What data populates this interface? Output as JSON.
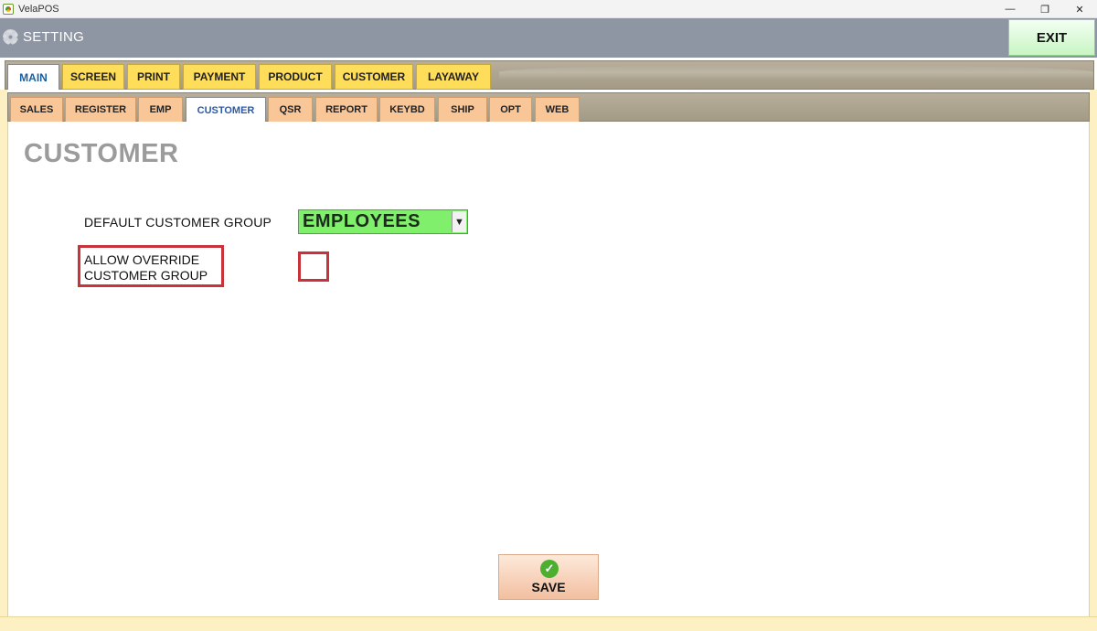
{
  "window": {
    "title": "VelaPOS",
    "controls": {
      "minimize": "—",
      "restore": "❐",
      "close": "✕"
    }
  },
  "header": {
    "title": "SETTING",
    "exit_label": "EXIT"
  },
  "main_tabs": [
    {
      "label": "MAIN",
      "active": true
    },
    {
      "label": "SCREEN",
      "active": false
    },
    {
      "label": "PRINT",
      "active": false
    },
    {
      "label": "PAYMENT",
      "active": false
    },
    {
      "label": "PRODUCT",
      "active": false
    },
    {
      "label": "CUSTOMER",
      "active": false
    },
    {
      "label": "LAYAWAY",
      "active": false
    }
  ],
  "sub_tabs": [
    {
      "label": "SALES",
      "active": false
    },
    {
      "label": "REGISTER",
      "active": false
    },
    {
      "label": "EMP",
      "active": false
    },
    {
      "label": "CUSTOMER",
      "active": true
    },
    {
      "label": "QSR",
      "active": false
    },
    {
      "label": "REPORT",
      "active": false
    },
    {
      "label": "KEYBD",
      "active": false
    },
    {
      "label": "SHIP",
      "active": false
    },
    {
      "label": "OPT",
      "active": false
    },
    {
      "label": "WEB",
      "active": false
    }
  ],
  "content": {
    "title": "CUSTOMER",
    "default_group_label": "DEFAULT CUSTOMER GROUP",
    "default_group_value": "EMPLOYEES",
    "override_label_line1": "ALLOW OVERRIDE",
    "override_label_line2": "CUSTOMER GROUP",
    "override_checked": false,
    "save_label": "SAVE"
  },
  "colors": {
    "main_tab": "#fddd59",
    "sub_tab": "#f9c698",
    "select_bg": "#7fef6c",
    "highlight": "#c8323b",
    "exit_bg": "#c9f5c3"
  }
}
